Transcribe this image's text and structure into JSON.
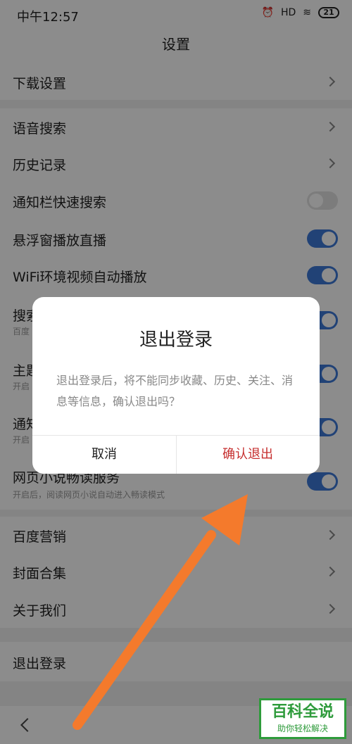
{
  "status": {
    "time": "中午12:57",
    "signal": "HD",
    "battery": "21"
  },
  "header": {
    "title": "设置"
  },
  "settings": {
    "download": "下载设置",
    "voice_search": "语音搜索",
    "history": "历史记录",
    "notification_search": "通知栏快速搜索",
    "floating_live": "悬浮窗播放直播",
    "wifi_autoplay": "WiFi环境视频自动播放",
    "row7_label": "搜索",
    "row7_sub": "百度",
    "row8_label": "主题",
    "row8_sub": "开启",
    "row9_label": "通知",
    "row9_sub": "开启",
    "novel_label": "网页小说畅读服务",
    "novel_sub": "开启后，阅读网页小说自动进入畅读模式",
    "baidu_marketing": "百度营销",
    "cover_collection": "封面合集",
    "about": "关于我们",
    "logout": "退出登录"
  },
  "toggles": {
    "notification_search": false,
    "floating_live": true,
    "wifi_autoplay": true,
    "row7": true,
    "row8": true,
    "row9": true,
    "novel": true
  },
  "dialog": {
    "title": "退出登录",
    "message": "退出登录后，将不能同步收藏、历史、关注、消息等信息，确认退出吗？",
    "cancel": "取消",
    "confirm": "确认退出",
    "confirm_color": "#c62f2f"
  },
  "watermark": {
    "main": "百科全说",
    "sub": "助你轻松解决"
  },
  "colors": {
    "toggle_on": "#3d78d8",
    "arrow": "#f47a2c",
    "watermark": "#2e9b3b"
  }
}
